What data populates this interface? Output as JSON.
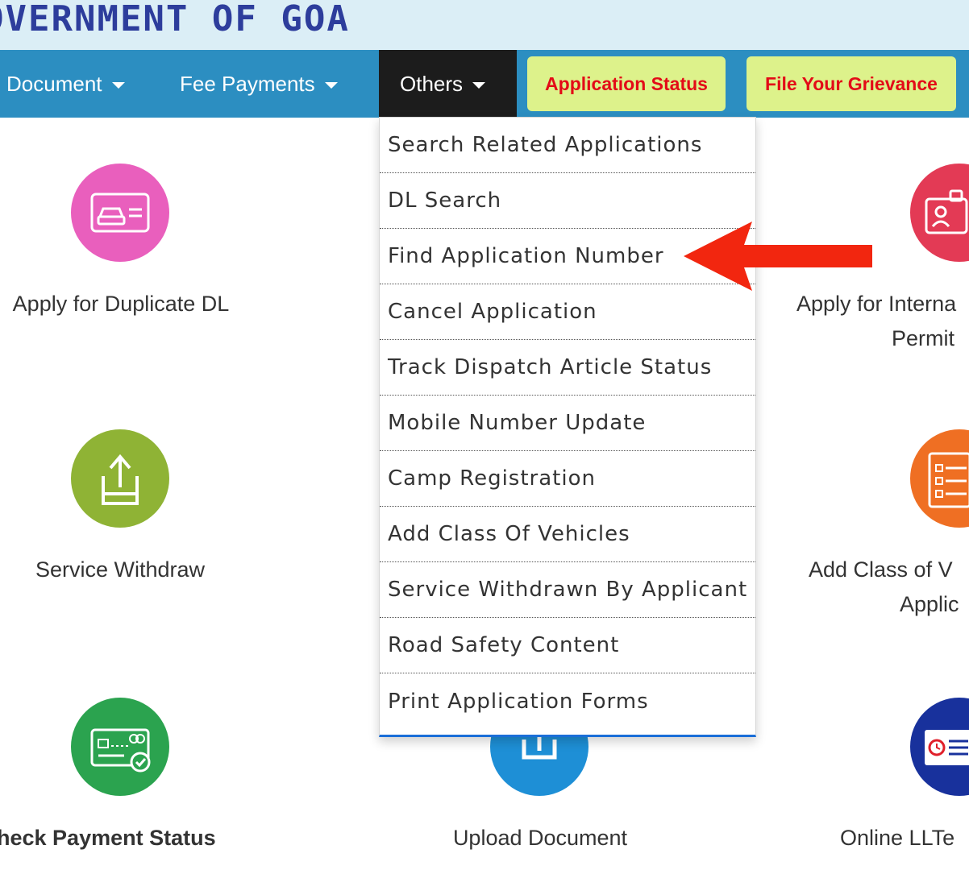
{
  "header": {
    "title": "OVERNMENT OF GOA"
  },
  "nav": {
    "items": [
      {
        "label": "Document"
      },
      {
        "label": "Fee Payments"
      },
      {
        "label": "Others"
      }
    ],
    "application_status": "Application Status",
    "file_grievance": "File Your Grievance"
  },
  "dropdown": {
    "items": [
      "Search Related Applications",
      "DL Search",
      "Find Application Number",
      "Cancel Application",
      "Track Dispatch Article Status",
      "Mobile Number Update",
      "Camp Registration",
      "Add Class Of Vehicles",
      "Service Withdrawn By Applicant",
      "Road Safety Content",
      "Print Application Forms"
    ]
  },
  "tiles": {
    "duplicate_dl": {
      "label": "Apply for Duplicate DL",
      "icon": "car-card-icon",
      "color": "#e95fbd"
    },
    "service_withdraw": {
      "label": "Service Withdraw",
      "icon": "upload-tray-icon",
      "color": "#8fb335"
    },
    "check_payment": {
      "label": "heck Payment Status",
      "icon": "payment-card-icon",
      "color": "#2ba34f"
    },
    "upload_document": {
      "label": "Upload Document",
      "icon": "upload-icon",
      "color": "#1e8fd6"
    },
    "international_permit": {
      "label_line1": "Apply for Interna",
      "label_line2": "Permit",
      "icon": "id-lock-icon",
      "color": "#e33a55"
    },
    "add_class": {
      "label_line1": "Add Class of V",
      "label_line2": "Applic",
      "icon": "checklist-icon",
      "color": "#ef6f23"
    },
    "online_ll": {
      "label": "Online LLTe",
      "icon": "clock-doc-icon",
      "color": "#18319c"
    }
  },
  "annotation": {
    "arrow_color": "#f2260f"
  }
}
